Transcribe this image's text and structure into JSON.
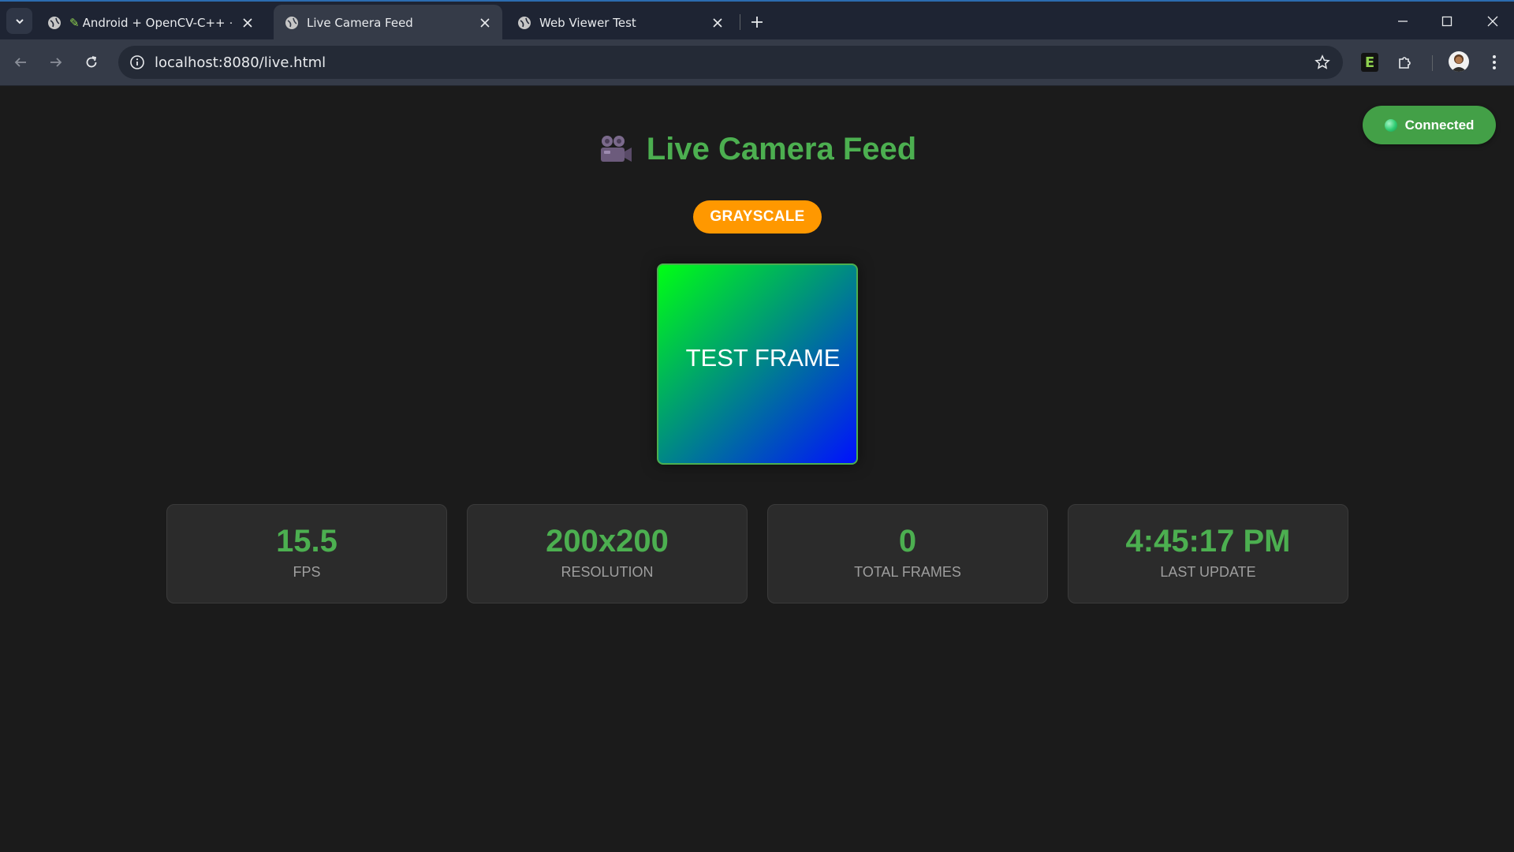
{
  "browser": {
    "tabs": [
      {
        "title": "Android + OpenCV-C++ + ·",
        "active": false
      },
      {
        "title": "Live Camera Feed",
        "active": true
      },
      {
        "title": "Web Viewer Test",
        "active": false
      }
    ],
    "url": "localhost:8080/live.html",
    "extension_letter": "E"
  },
  "page": {
    "status": "Connected",
    "title": "Live Camera Feed",
    "mode": "GRAYSCALE",
    "frame_text": "TEST FRAME",
    "stats": [
      {
        "value": "15.5",
        "label": "FPS"
      },
      {
        "value": "200x200",
        "label": "RESOLUTION"
      },
      {
        "value": "0",
        "label": "TOTAL FRAMES"
      },
      {
        "value": "4:45:17 PM",
        "label": "LAST UPDATE"
      }
    ]
  },
  "colors": {
    "accent_green": "#4caf50",
    "badge_orange": "#ff9800",
    "page_bg": "#1b1b1b",
    "card_bg": "#2b2b2b"
  }
}
